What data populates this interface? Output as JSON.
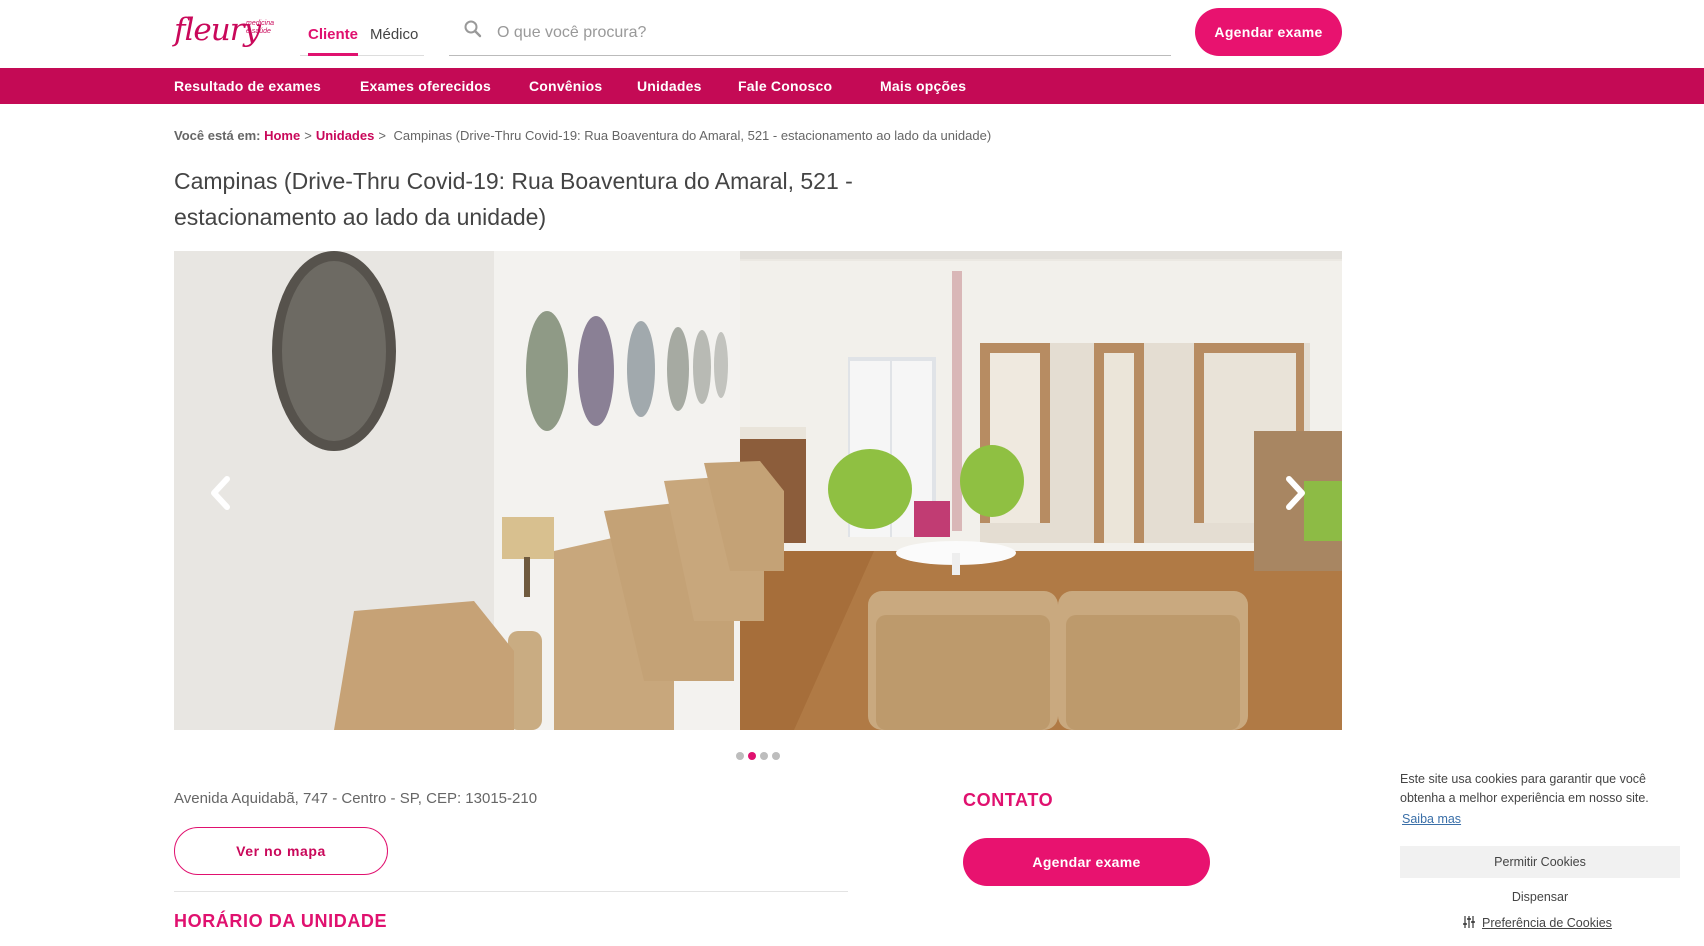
{
  "header": {
    "logo_text": "fleury",
    "logo_tagline": "medicina e saúde",
    "profile_tabs": [
      "Cliente",
      "Médico"
    ],
    "search_placeholder": "O que você procura?",
    "schedule_button": "Agendar exame"
  },
  "nav": {
    "items": [
      "Resultado de exames",
      "Exames oferecidos",
      "Convênios",
      "Unidades",
      "Fale Conosco",
      "Mais opções"
    ]
  },
  "breadcrumb": {
    "label": "Você está em:",
    "links": [
      "Home",
      "Unidades"
    ],
    "current": "Campinas (Drive-Thru Covid-19: Rua Boaventura do Amaral, 521 - estacionamento ao lado da unidade)"
  },
  "page": {
    "title": "Campinas (Drive-Thru Covid-19: Rua Boaventura do Amaral, 521 - estacionamento ao lado da unidade)"
  },
  "carousel": {
    "slide_count": 4,
    "active_index": 1,
    "image_alt": "Sala de espera da unidade Fleury Campinas"
  },
  "unit": {
    "address": "Avenida Aquidabã, 747 - Centro - SP, CEP: 13015-210",
    "map_button": "Ver no mapa",
    "hours_title": "HORÁRIO DA UNIDADE"
  },
  "contact": {
    "title": "CONTATO",
    "schedule_button": "Agendar exame"
  },
  "cookie_banner": {
    "message": "Este site usa cookies para garantir que você obtenha a melhor experiência em nosso site.",
    "learn_more": "Saiba mas",
    "allow_button": "Permitir Cookies",
    "dismiss_button": "Dispensar",
    "preferences_link": "Preferência de Cookies"
  },
  "colors": {
    "brand_pink": "#e8126f",
    "nav_magenta": "#c40a55"
  }
}
